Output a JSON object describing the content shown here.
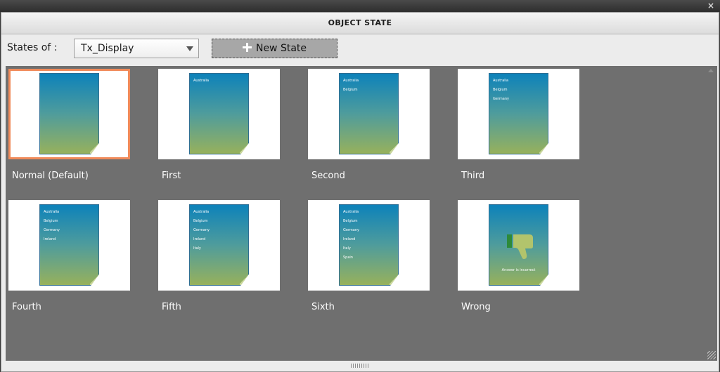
{
  "window": {
    "title": "OBJECT STATE",
    "close_glyph": "×"
  },
  "toolbar": {
    "states_of_label": "States of :",
    "selected_object": "Tx_Display",
    "new_state_label": "New State"
  },
  "states": [
    {
      "label": "Normal (Default)",
      "selected": true,
      "lines": []
    },
    {
      "label": "First",
      "lines": [
        "Australia"
      ]
    },
    {
      "label": "Second",
      "lines": [
        "Australia",
        "Belgium"
      ]
    },
    {
      "label": "Third",
      "lines": [
        "Australia",
        "Belgium",
        "Germany"
      ]
    },
    {
      "label": "Fourth",
      "lines": [
        "Australia",
        "Belgium",
        "Germany",
        "Ireland"
      ]
    },
    {
      "label": "Fifth",
      "lines": [
        "Australia",
        "Belgium",
        "Germany",
        "Ireland",
        "Italy"
      ]
    },
    {
      "label": "Sixth",
      "lines": [
        "Australia",
        "Belgium",
        "Germany",
        "Ireland",
        "Italy",
        "Spain"
      ]
    },
    {
      "label": "Wrong",
      "lines": [],
      "icon": "thumbs-down-icon",
      "caption": "Answer is incorrect"
    }
  ],
  "colors": {
    "selection_border": "#f08a5a",
    "doc_top": "#0d82ba",
    "doc_bottom": "#97b15c",
    "grid_background": "#6f6f6f"
  }
}
